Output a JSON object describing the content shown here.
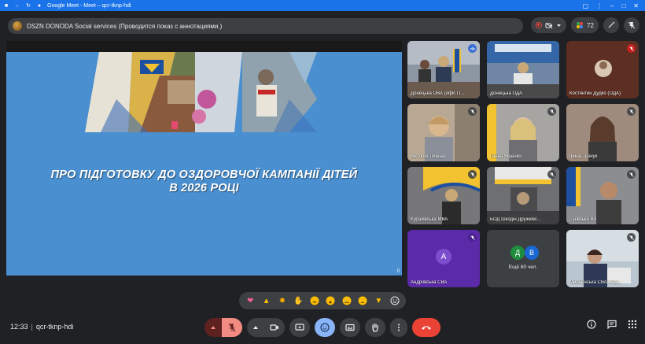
{
  "window": {
    "title": "Google Meet - Meet – qcr-tknp-hdi"
  },
  "topbar": {
    "presentation_label": "DSZN DONODA Social services (Проводится показ с аннотациями.)",
    "participants_count": "72"
  },
  "slide": {
    "title_line1": "ПРО ПІДГОТОВКУ ДО ОЗДОРОВЧОЇ КАМПАНІЇ ДІТЕЙ",
    "title_line2": "В 2026 РОЦІ",
    "page_number": "0"
  },
  "participants": [
    {
      "name": "Донецька ОВА (офіс П...",
      "bg": "#8d97a3"
    },
    {
      "name": "Донецька ОДА",
      "bg": "#6f86a4"
    },
    {
      "name": "Костянтин Дудко (ОДА)",
      "bg": "#5d2e22"
    },
    {
      "name": "Вікторія Точена",
      "bg": "#b7a793"
    },
    {
      "name": "Ганна Ященко",
      "bg": "#a6a5a1"
    },
    {
      "name": "Ірина Трачук",
      "bg": "#9f8b7d"
    },
    {
      "name": "Курахівська МВА",
      "bg": "#77777a"
    },
    {
      "name": "БОД Шкодін Дружківс...",
      "bg": "#6d6f72"
    },
    {
      "name": "...нівська ВА",
      "bg": "#8b8d90"
    },
    {
      "name": "Андріївська СВА",
      "letter": "А",
      "bg": "#5b2aa8"
    },
    {
      "name": "Ещё 60 чел.",
      "letters": [
        "Д",
        "В"
      ]
    },
    {
      "name": "Мирненська СВА Наді...",
      "bg": "#b9c6cf"
    }
  ],
  "reactions": [
    "sparkling-heart",
    "thumbs-up",
    "party-popper",
    "clapping-hands",
    "laughing-face",
    "surprised-face",
    "crying-face",
    "thinking-face",
    "thumbs-down",
    "add-reaction"
  ],
  "footer": {
    "time": "12:33",
    "meeting_code": "qcr-tknp-hdi"
  },
  "colors": {
    "accent": "#8ab4f8",
    "hangup": "#ea4335",
    "slide_bg": "#4a8fcf"
  }
}
